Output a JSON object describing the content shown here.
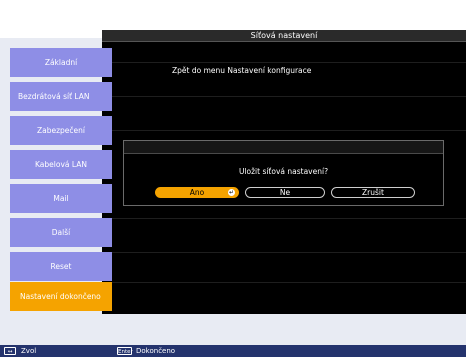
{
  "window": {
    "title": "Síťová nastavení"
  },
  "sidebar": {
    "items": [
      {
        "label": "Základní"
      },
      {
        "label": "Bezdrátová síť LAN"
      },
      {
        "label": "Zabezpečení"
      },
      {
        "label": "Kabelová LAN"
      },
      {
        "label": "Mail"
      },
      {
        "label": "Další"
      },
      {
        "label": "Reset"
      },
      {
        "label": "Nastavení dokončeno"
      }
    ]
  },
  "main": {
    "back_link": "Zpět do menu Nastavení konfigurace"
  },
  "dialog": {
    "question": "Uložit síťová nastavení?",
    "buttons": {
      "yes": "Ano",
      "no": "Ne",
      "cancel": "Zrušit"
    }
  },
  "footer": {
    "select_key": "↔",
    "select_label": "Zvol",
    "enter_key": "Enter",
    "enter_label": "Dokončeno"
  },
  "colors": {
    "accent": "#f5a300",
    "sidebar_item": "#8e8ee6",
    "footer_bar": "#24336d",
    "panel": "#000000"
  }
}
